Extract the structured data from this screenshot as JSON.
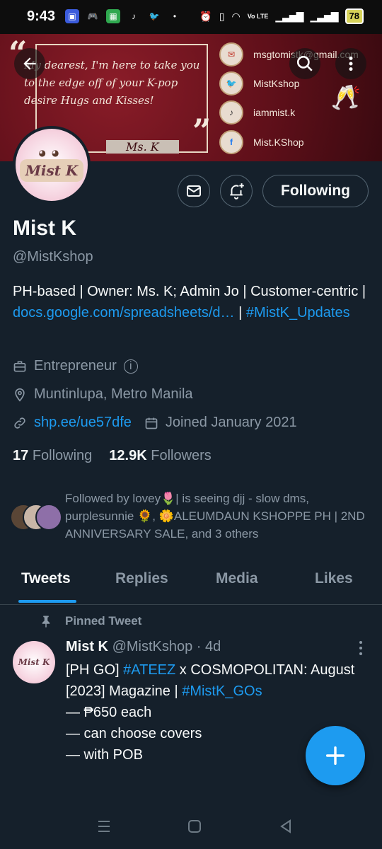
{
  "status_bar": {
    "time": "9:43",
    "battery": "78",
    "network": "Vo LTE"
  },
  "banner": {
    "quote": "My dearest, I'm here to take you to the edge off of your K-pop desire Hugs and Kisses!",
    "signature": "Ms. K",
    "contacts": [
      {
        "icon": "mail-icon",
        "text": "msgtomistk@gmail.com"
      },
      {
        "icon": "twitter-icon",
        "text": "MistKshop"
      },
      {
        "icon": "tiktok-icon",
        "text": "iammist.k"
      },
      {
        "icon": "facebook-messenger-icon",
        "text": "Mist.KShop"
      }
    ],
    "avatar_brand": "Mist K",
    "colors": {
      "banner_red": "#7a1522",
      "accent_cream": "#f2e6da"
    }
  },
  "profile": {
    "display_name": "Mist K",
    "handle": "@MistKshop",
    "bio_text": "PH-based | Owner: Ms. K; Admin Jo | Customer-centric |",
    "bio_link": "docs.google.com/spreadsheets/d…",
    "bio_sep": "|",
    "bio_hashtag": "#MistK_Updates",
    "category": "Entrepreneur",
    "location": "Muntinlupa, Metro Manila",
    "website": "shp.ee/ue57dfe",
    "joined": "Joined January 2021",
    "following_count": "17",
    "following_label": "Following",
    "followers_count": "12.9K",
    "followers_label": "Followers",
    "followed_by": "Followed by lovey🌷| is seeing djj - slow dms, purplesunnie 🌻, 🌼ALEUMDAUN KSHOPPE PH | 2ND ANNIVERSARY SALE, and 3 others",
    "following_button": "Following"
  },
  "tabs": [
    "Tweets",
    "Replies",
    "Media",
    "Likes"
  ],
  "pinned_tweet": {
    "pinned_label": "Pinned Tweet",
    "author": "Mist K",
    "handle_time": "@MistKshop · 4d",
    "line1_a": "[PH GO] ",
    "line1_tag": "#ATEEZ",
    "line1_b": " x COSMOPOLITAN: August [2023] Magazine | ",
    "line1_tag2": "#MistK_GOs",
    "rest": "\n— ₱650 each\n— can choose covers\n— with POB",
    "avatar_text": "Mist K"
  },
  "colors": {
    "background": "#15202b",
    "accent": "#1d9bf0",
    "muted": "#8b98a5"
  }
}
